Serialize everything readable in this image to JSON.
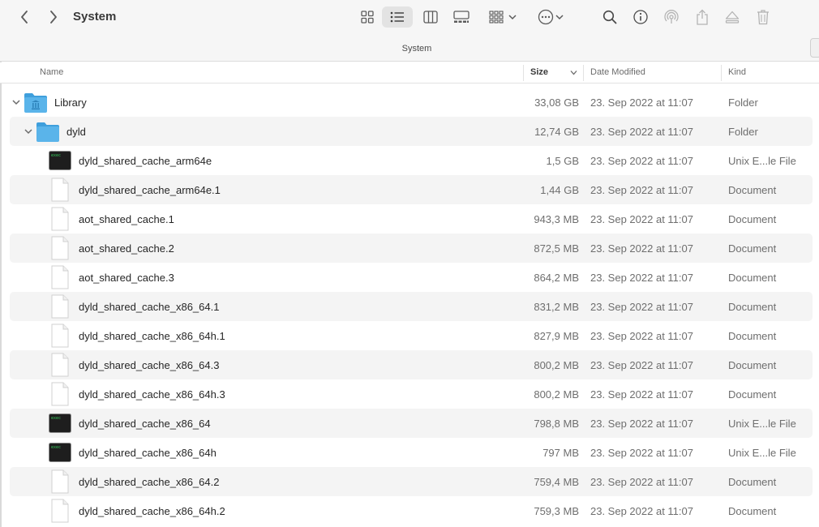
{
  "window": {
    "title": "System"
  },
  "path_bar": {
    "label": "System"
  },
  "columns": {
    "name": "Name",
    "size": "Size",
    "date_modified": "Date Modified",
    "kind": "Kind"
  },
  "rows": [
    {
      "name": "Library",
      "size": "33,08 GB",
      "date": "23. Sep 2022 at 11:07",
      "kind": "Folder",
      "icon": "folder-library-icon",
      "level": 0,
      "expanded": true
    },
    {
      "name": "dyld",
      "size": "12,74 GB",
      "date": "23. Sep 2022 at 11:07",
      "kind": "Folder",
      "icon": "folder-icon",
      "level": 1,
      "expanded": true
    },
    {
      "name": "dyld_shared_cache_arm64e",
      "size": "1,5 GB",
      "date": "23. Sep 2022 at 11:07",
      "kind": "Unix E...le File",
      "icon": "terminal-exec-icon",
      "level": 2
    },
    {
      "name": "dyld_shared_cache_arm64e.1",
      "size": "1,44 GB",
      "date": "23. Sep 2022 at 11:07",
      "kind": "Document",
      "icon": "document-icon",
      "level": 2
    },
    {
      "name": "aot_shared_cache.1",
      "size": "943,3 MB",
      "date": "23. Sep 2022 at 11:07",
      "kind": "Document",
      "icon": "document-icon",
      "level": 2
    },
    {
      "name": "aot_shared_cache.2",
      "size": "872,5 MB",
      "date": "23. Sep 2022 at 11:07",
      "kind": "Document",
      "icon": "document-icon",
      "level": 2
    },
    {
      "name": "aot_shared_cache.3",
      "size": "864,2 MB",
      "date": "23. Sep 2022 at 11:07",
      "kind": "Document",
      "icon": "document-icon",
      "level": 2
    },
    {
      "name": "dyld_shared_cache_x86_64.1",
      "size": "831,2 MB",
      "date": "23. Sep 2022 at 11:07",
      "kind": "Document",
      "icon": "document-icon",
      "level": 2
    },
    {
      "name": "dyld_shared_cache_x86_64h.1",
      "size": "827,9 MB",
      "date": "23. Sep 2022 at 11:07",
      "kind": "Document",
      "icon": "document-icon",
      "level": 2
    },
    {
      "name": "dyld_shared_cache_x86_64.3",
      "size": "800,2 MB",
      "date": "23. Sep 2022 at 11:07",
      "kind": "Document",
      "icon": "document-icon",
      "level": 2
    },
    {
      "name": "dyld_shared_cache_x86_64h.3",
      "size": "800,2 MB",
      "date": "23. Sep 2022 at 11:07",
      "kind": "Document",
      "icon": "document-icon",
      "level": 2
    },
    {
      "name": "dyld_shared_cache_x86_64",
      "size": "798,8 MB",
      "date": "23. Sep 2022 at 11:07",
      "kind": "Unix E...le File",
      "icon": "terminal-exec-icon",
      "level": 2
    },
    {
      "name": "dyld_shared_cache_x86_64h",
      "size": "797 MB",
      "date": "23. Sep 2022 at 11:07",
      "kind": "Unix E...le File",
      "icon": "terminal-exec-icon",
      "level": 2
    },
    {
      "name": "dyld_shared_cache_x86_64.2",
      "size": "759,4 MB",
      "date": "23. Sep 2022 at 11:07",
      "kind": "Document",
      "icon": "document-icon",
      "level": 2
    },
    {
      "name": "dyld_shared_cache_x86_64h.2",
      "size": "759,3 MB",
      "date": "23. Sep 2022 at 11:07",
      "kind": "Document",
      "icon": "document-icon",
      "level": 2
    }
  ],
  "colors": {
    "folder_blue": "#5ab4ea",
    "row_stripe": "#f4f4f4",
    "toolbar_bg": "#f6f6f6",
    "terminal_green": "#34c759"
  }
}
